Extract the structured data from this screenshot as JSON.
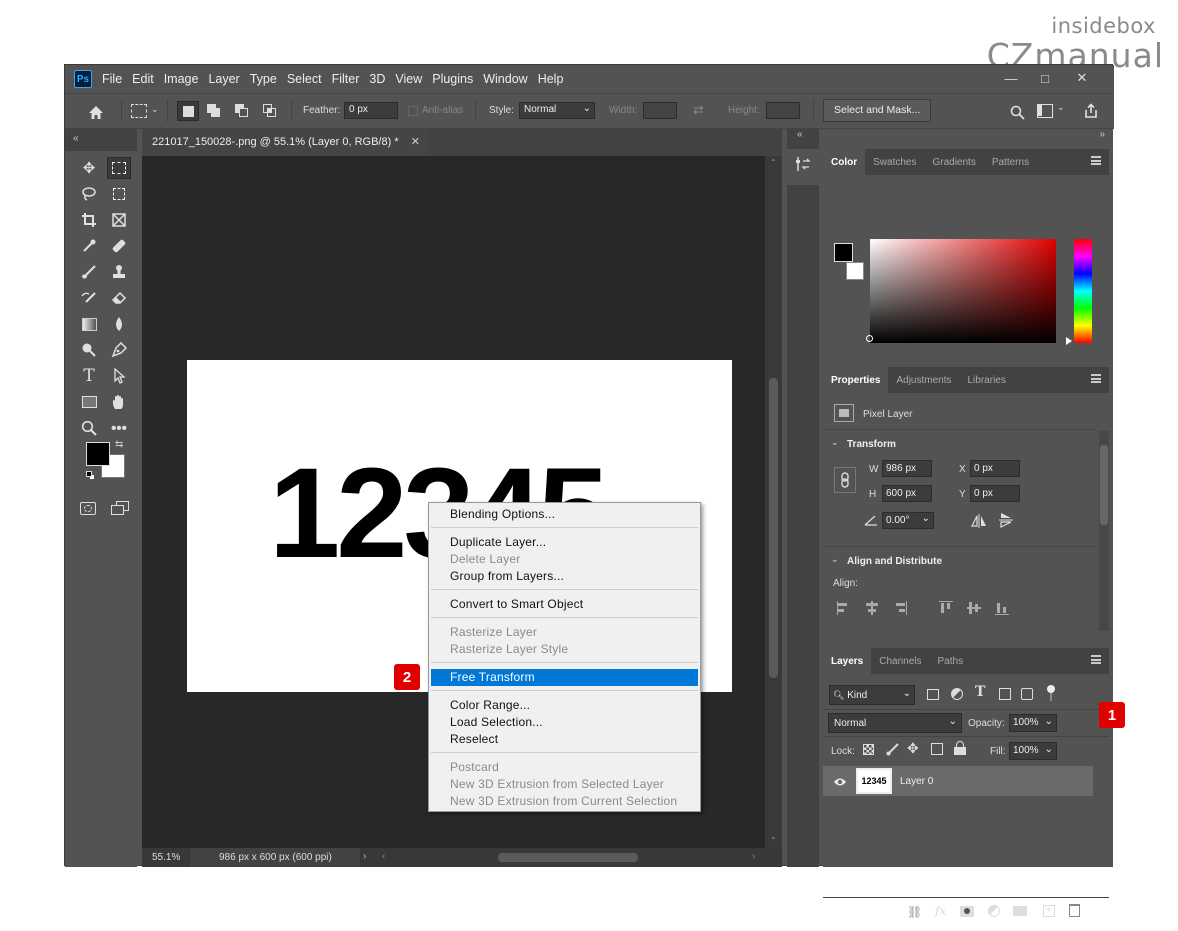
{
  "watermark": {
    "line1": "insidebox",
    "line2": "CZmanual"
  },
  "app": {
    "logo": "Ps",
    "menu": [
      "File",
      "Edit",
      "Image",
      "Layer",
      "Type",
      "Select",
      "Filter",
      "3D",
      "View",
      "Plugins",
      "Window",
      "Help"
    ]
  },
  "window_controls": {
    "minimize": "—",
    "maximize": "□",
    "close": "✕"
  },
  "options": {
    "feather_label": "Feather:",
    "feather_value": "0 px",
    "antialias_label": "Anti-alias",
    "style_label": "Style:",
    "style_value": "Normal",
    "width_label": "Width:",
    "height_label": "Height:",
    "select_mask": "Select and Mask..."
  },
  "document": {
    "tab_title": "221017_150028-.png @ 55.1% (Layer 0, RGB/8) *",
    "canvas_text": "12345",
    "zoom": "55.1%",
    "dimensions": "986 px x 600 px (600 ppi)"
  },
  "context_menu": {
    "blending": "Blending Options...",
    "duplicate": "Duplicate Layer...",
    "delete": "Delete Layer",
    "group": "Group from Layers...",
    "smart": "Convert to Smart Object",
    "rasterize": "Rasterize Layer",
    "rasterize_style": "Rasterize Layer Style",
    "free_transform": "Free Transform",
    "color_range": "Color Range...",
    "load_selection": "Load Selection...",
    "reselect": "Reselect",
    "postcard": "Postcard",
    "extrusion_layer": "New 3D Extrusion from Selected Layer",
    "extrusion_selection": "New 3D Extrusion from Current Selection"
  },
  "badges": {
    "one": "1",
    "two": "2"
  },
  "color_panel": {
    "tabs": [
      "Color",
      "Swatches",
      "Gradients",
      "Patterns"
    ]
  },
  "properties_panel": {
    "tabs": [
      "Properties",
      "Adjustments",
      "Libraries"
    ],
    "layer_type": "Pixel Layer",
    "transform_title": "Transform",
    "w_label": "W",
    "w_value": "986 px",
    "h_label": "H",
    "h_value": "600 px",
    "x_label": "X",
    "x_value": "0 px",
    "y_label": "Y",
    "y_value": "0 px",
    "angle_value": "0.00°",
    "align_title": "Align and Distribute",
    "align_label": "Align:"
  },
  "layers_panel": {
    "tabs": [
      "Layers",
      "Channels",
      "Paths"
    ],
    "kind": "Kind",
    "blend_mode": "Normal",
    "opacity_label": "Opacity:",
    "opacity_value": "100%",
    "lock_label": "Lock:",
    "fill_label": "Fill:",
    "fill_value": "100%",
    "layer_name": "Layer 0",
    "thumb_text": "12345",
    "footer_fx": "fx"
  },
  "colors": {
    "accent": "#0078d7",
    "badge": "#e10000",
    "panel": "#535353",
    "canvas_bg": "#282828"
  }
}
